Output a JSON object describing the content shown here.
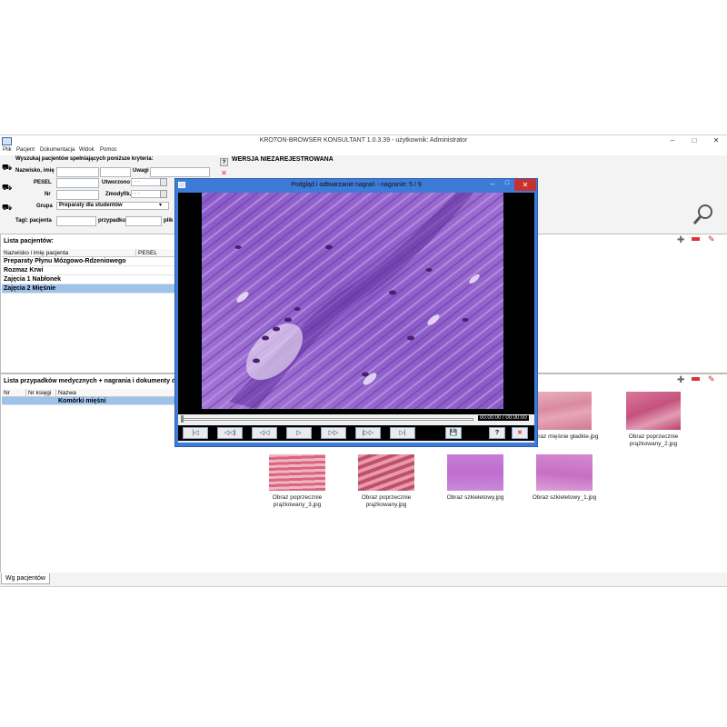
{
  "app": {
    "title": "KROTON-BROWSER KONSULTANT 1.0.3.39 - użytkownik: Administrator",
    "window_controls": [
      "–",
      "□",
      "✕"
    ]
  },
  "menu": [
    "Plik",
    "Pacjent",
    "Dokumentacja",
    "Widok",
    "Pomoc"
  ],
  "search": {
    "heading": "Wyszukaj pacjentów spełniających poniższe kryteria:",
    "name_label": "Nazwisko, imię",
    "uwagi_label": "Uwagi",
    "pesel_label": "PESEL",
    "utworzono_label": "Utworzono",
    "nr_label": "Nr",
    "zmodyfik_label": "Zmodyfik.",
    "grupa_label": "Grupa",
    "grupa_value": "Preparaty dla studentów",
    "date_placeholder": "- -",
    "tagi_pacjenta_label": "Tagi: pacjenta",
    "przypadku_label": "przypadku",
    "plik_label": "plik",
    "help_btn": "?",
    "clear_btn": "✕"
  },
  "banner": "WERSJA NIEZAREJESTROWANA",
  "patients": {
    "title": "Lista pacjentów:",
    "col_name": "Nazwisko i imię pacjenta",
    "col_pesel": "PESEL",
    "rows": [
      "Preparaty Płynu Mózgowo-Rdzeniowego",
      "Rozmaz Krwi",
      "Zajęcia 1 Nabłonek",
      "Zajęcia 2 Mięśnie"
    ],
    "selected_index": 3
  },
  "cases": {
    "title": "Lista przypadków medycznych + nagrania i dokumenty dl",
    "col_nr": "Nr",
    "col_ksiegi": "Nr księgi",
    "col_nazwa": "Nazwa",
    "rows": [
      "Komórki mięśni"
    ]
  },
  "gallery": {
    "row1": [
      {
        "caption": "Obraz mięśnie gładkie.jpg",
        "color": "#d98aa0"
      },
      {
        "caption": "Obraz poprzecznie prążkowany_2.jpg",
        "color": "#c5527e"
      }
    ],
    "row2": [
      {
        "caption": "Obraz poprzecznie prążkowany_3.jpg",
        "color": "#d9657f"
      },
      {
        "caption": "Obraz poprzecznie prążkowany.jpg",
        "color": "#c0506a"
      },
      {
        "caption": "Obraz szkieletowy.jpg",
        "color": "#bf6ccf"
      },
      {
        "caption": "Obraz szkieletowy_1.jpg",
        "color": "#c86fc4"
      }
    ]
  },
  "bottom_tab": "Wg pacjentów",
  "player": {
    "title": "Podgląd i odtwarzanie nagrań - nagranie: 5 / 9",
    "time": "00:00:00 / 00:00:00",
    "buttons": {
      "first": "|◁",
      "prev_frame": "◁◁|",
      "rewind": "◁◁",
      "play": "▷",
      "forward": "▷▷",
      "next_frame": "|▷▷",
      "last": "▷|",
      "save": "💾",
      "help": "?",
      "close": "✕"
    },
    "progress": 0
  }
}
